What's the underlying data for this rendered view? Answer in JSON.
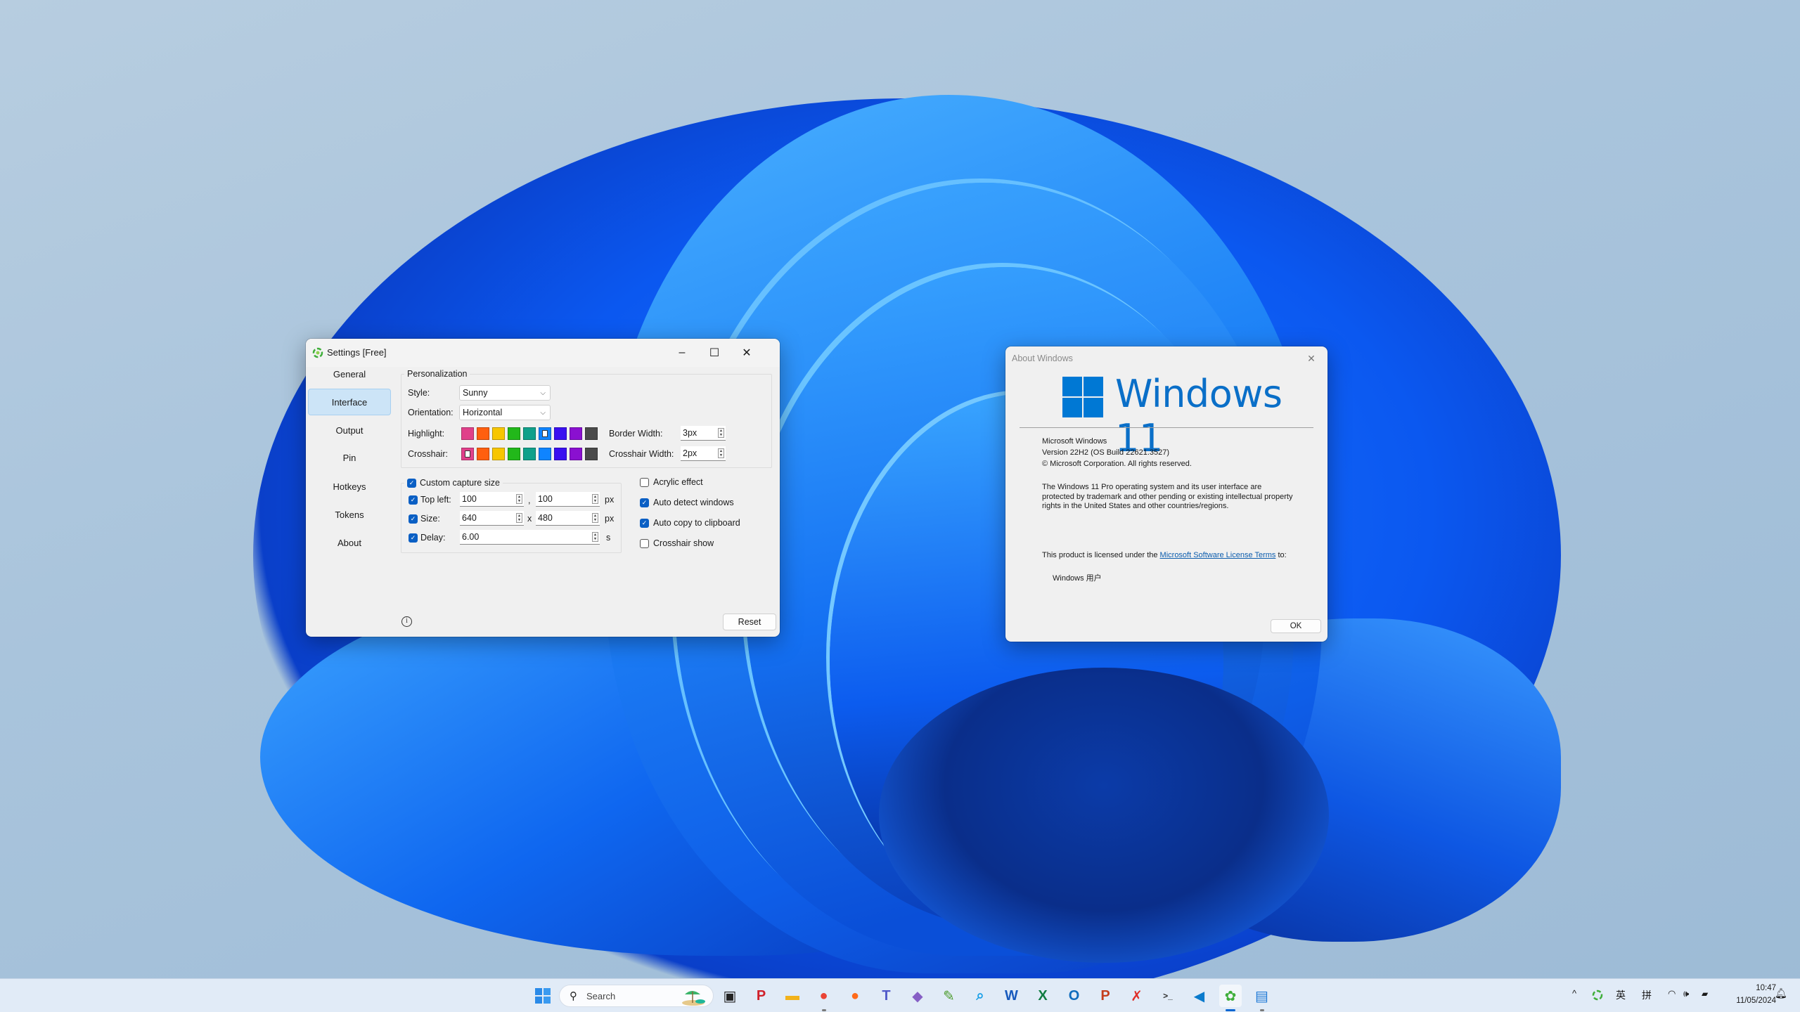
{
  "settings_window": {
    "title": "Settings [Free]",
    "controls": {
      "minimize": "–",
      "maximize": "☐",
      "close": "✕"
    },
    "sidebar": [
      {
        "label": "General",
        "active": false
      },
      {
        "label": "Interface",
        "active": true
      },
      {
        "label": "Output",
        "active": false
      },
      {
        "label": "Pin",
        "active": false
      },
      {
        "label": "Hotkeys",
        "active": false
      },
      {
        "label": "Tokens",
        "active": false
      },
      {
        "label": "About",
        "active": false
      }
    ],
    "personalization": {
      "title": "Personalization",
      "style_label": "Style:",
      "style_value": "Sunny",
      "orientation_label": "Orientation:",
      "orientation_value": "Horizontal",
      "highlight_label": "Highlight:",
      "crosshair_label": "Crosshair:",
      "highlight_colors": [
        "#e0408a",
        "#ff5f0f",
        "#f7c600",
        "#22b81a",
        "#10a08a",
        "#0f84ff",
        "#3a10f0",
        "#8a10d0",
        "#4a4a4a"
      ],
      "highlight_selected": 5,
      "crosshair_colors": [
        "#e0408a",
        "#ff5f0f",
        "#f7c600",
        "#22b81a",
        "#10a08a",
        "#0f84ff",
        "#3a10f0",
        "#8a10d0",
        "#4a4a4a"
      ],
      "crosshair_selected": 0,
      "border_width_label": "Border Width:",
      "border_width_value": "3px",
      "crosshair_width_label": "Crosshair Width:",
      "crosshair_width_value": "2px"
    },
    "capture": {
      "title": "Custom capture size",
      "checked": true,
      "top_left_label": "Top left:",
      "top_left_checked": true,
      "top_left_x": "100",
      "top_left_sep": ",",
      "top_left_y": "100",
      "top_left_unit": "px",
      "size_label": "Size:",
      "size_checked": true,
      "size_w": "640",
      "size_sep": "x",
      "size_h": "480",
      "size_unit": "px",
      "delay_label": "Delay:",
      "delay_checked": true,
      "delay_value": "6.00",
      "delay_unit": "s"
    },
    "options": [
      {
        "label": "Acrylic effect",
        "checked": false
      },
      {
        "label": "Auto detect windows",
        "checked": true
      },
      {
        "label": "Auto copy to clipboard",
        "checked": true
      },
      {
        "label": "Crosshair show",
        "checked": false
      }
    ],
    "info_icon": "i",
    "reset_label": "Reset"
  },
  "about_window": {
    "title": "About Windows",
    "close": "✕",
    "logo_text": "Windows 11",
    "product": "Microsoft Windows",
    "version": "Version 22H2 (OS Build 22621.3527)",
    "copyright": "© Microsoft Corporation. All rights reserved.",
    "legal": "The Windows 11 Pro operating system and its user interface are protected by trademark and other pending or existing intellectual property rights in the United States and other countries/regions.",
    "license_prefix": "This product is licensed under the ",
    "license_link": "Microsoft Software License Terms",
    "license_suffix": " to:",
    "licensee": "Windows 用户",
    "ok_label": "OK"
  },
  "taskbar": {
    "search_placeholder": "Search",
    "apps": [
      {
        "name": "task-view",
        "glyph": "▣",
        "color": "#222222"
      },
      {
        "name": "red-app",
        "glyph": "P",
        "color": "#d0202a"
      },
      {
        "name": "file-explorer",
        "glyph": "▬",
        "color": "#f2b21c"
      },
      {
        "name": "chrome",
        "glyph": "●",
        "color": "#ea4335",
        "running": true
      },
      {
        "name": "firefox",
        "glyph": "●",
        "color": "#ff6a1a"
      },
      {
        "name": "teams",
        "glyph": "T",
        "color": "#5059c9"
      },
      {
        "name": "visual-studio",
        "glyph": "◆",
        "color": "#865fc5"
      },
      {
        "name": "notepad-edit",
        "glyph": "✎",
        "color": "#4a9a2a"
      },
      {
        "name": "magnifier-search",
        "glyph": "⌕",
        "color": "#1aa0e8"
      },
      {
        "name": "word",
        "glyph": "W",
        "color": "#185abd"
      },
      {
        "name": "excel",
        "glyph": "X",
        "color": "#107c41"
      },
      {
        "name": "outlook",
        "glyph": "O",
        "color": "#0f6cbd"
      },
      {
        "name": "powerpoint",
        "glyph": "P",
        "color": "#c43e1c"
      },
      {
        "name": "xmind",
        "glyph": "✗",
        "color": "#e0302a"
      },
      {
        "name": "terminal",
        "glyph": ">_",
        "color": "#2d2d2d"
      },
      {
        "name": "vscode",
        "glyph": "◀",
        "color": "#0a7acc"
      },
      {
        "name": "screenshot-app",
        "glyph": "✿",
        "color": "#3fae3a",
        "active": true
      },
      {
        "name": "window-app",
        "glyph": "▤",
        "color": "#1e78d6",
        "running": true
      }
    ],
    "tray": {
      "chevron": "^",
      "ime_lang": "英",
      "ime_mode": "拼",
      "time": "10:47",
      "date": "11/05/2024"
    }
  }
}
